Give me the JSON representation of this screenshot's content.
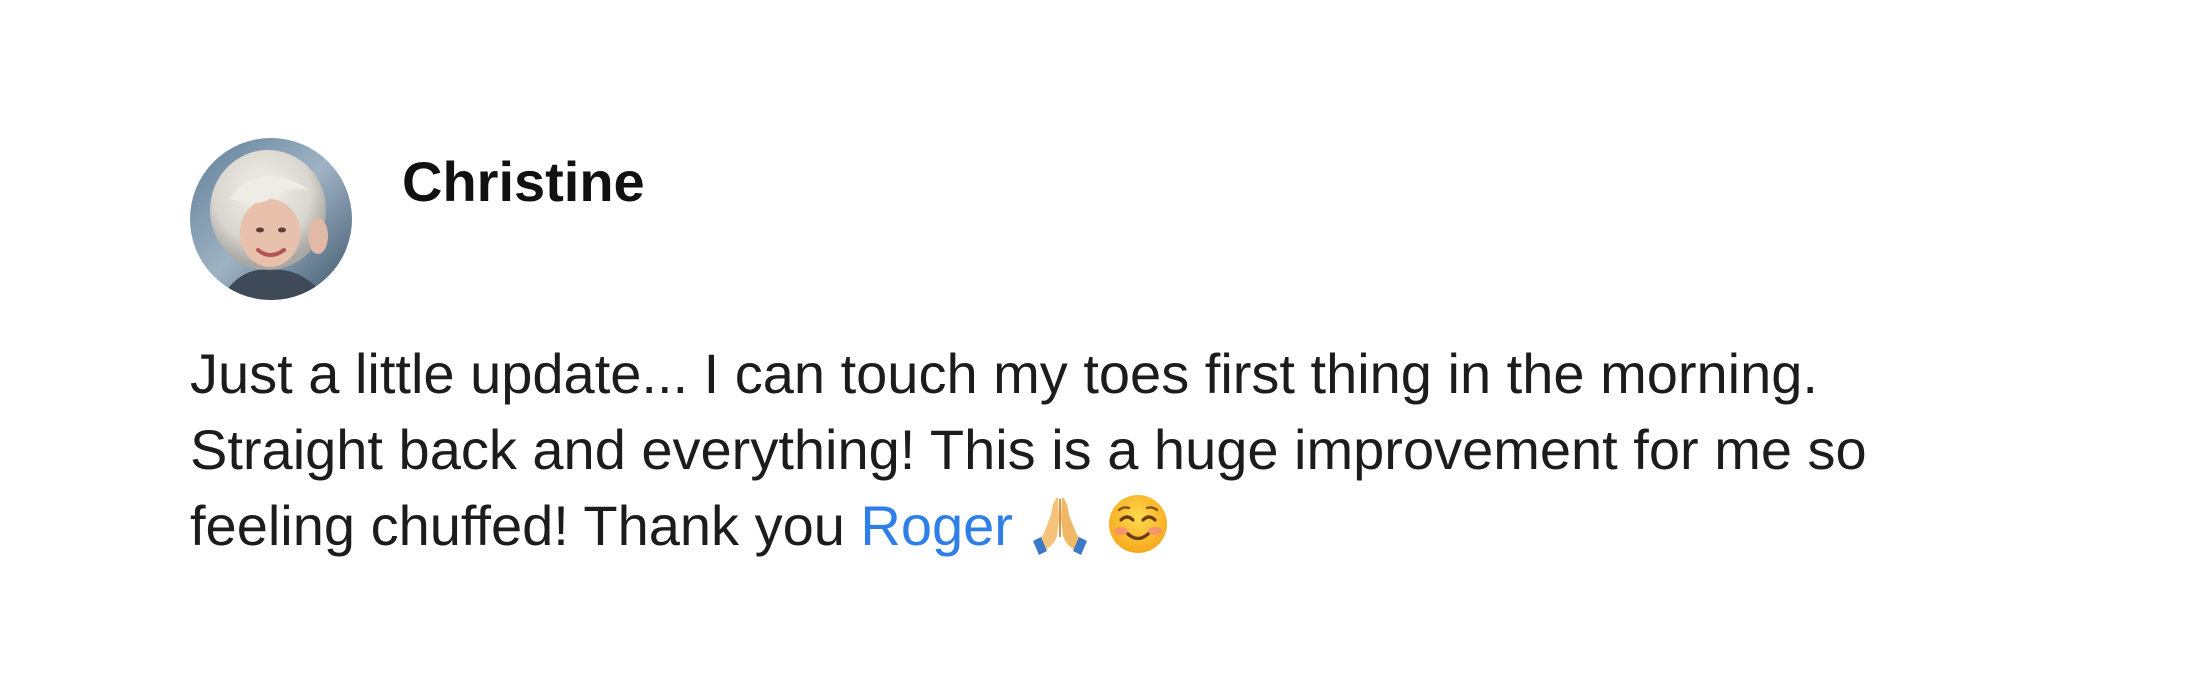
{
  "post": {
    "author": {
      "name": "Christine",
      "avatar_alt": "Christine"
    },
    "body": {
      "line1": "Just a little update... I can touch my toes first thing in the morning.",
      "line2": "Straight back and everything! This is a huge improvement for me so",
      "line3_prefix": "feeling chuffed! Thank you",
      "mention": "Roger",
      "emojis": [
        "folded-hands-icon",
        "smiling-face-icon"
      ]
    }
  },
  "colors": {
    "mention": "#2f7fe8",
    "text": "#1c1c1e",
    "background": "#ffffff"
  }
}
